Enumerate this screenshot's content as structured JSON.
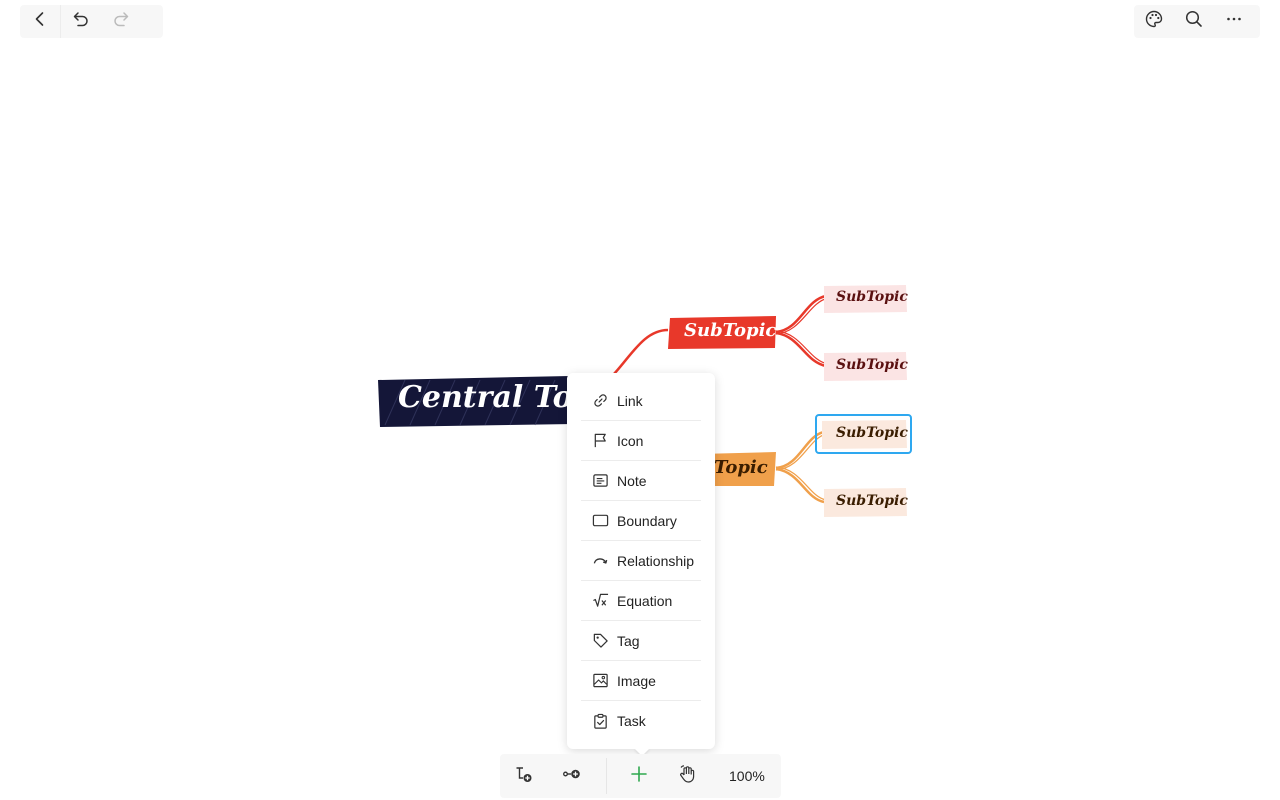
{
  "top_toolbar": {
    "left_icons": [
      "back-chevron-icon",
      "undo-icon",
      "redo-icon"
    ],
    "right_icons": [
      "palette-icon",
      "search-icon",
      "more-icon"
    ]
  },
  "mindmap": {
    "central": "Central Topic",
    "main1": "SubTopic",
    "main2": "Topic",
    "sub1": "SubTopic",
    "sub2": "SubTopic",
    "sub3": "SubTopic",
    "sub4": "SubTopic",
    "colors": {
      "central": "#141638",
      "main1": "#e8382a",
      "main2": "#f0a04b",
      "sub_fill": "#fbe4e4",
      "selection": "#2ea8f0"
    }
  },
  "insert_menu": {
    "items": [
      {
        "label": "Link",
        "icon": "link-icon"
      },
      {
        "label": "Icon",
        "icon": "flag-icon"
      },
      {
        "label": "Note",
        "icon": "note-icon"
      },
      {
        "label": "Boundary",
        "icon": "boundary-icon"
      },
      {
        "label": "Relationship",
        "icon": "relationship-icon"
      },
      {
        "label": "Equation",
        "icon": "equation-icon"
      },
      {
        "label": "Tag",
        "icon": "tag-icon"
      },
      {
        "label": "Image",
        "icon": "image-icon"
      },
      {
        "label": "Task",
        "icon": "task-icon"
      }
    ]
  },
  "bottom_toolbar": {
    "zoom": "100%",
    "plus_color": "#2fa84f"
  }
}
